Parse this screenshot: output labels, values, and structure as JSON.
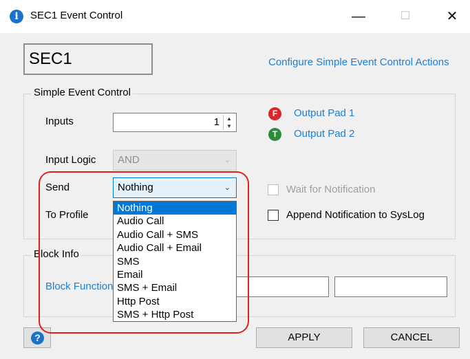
{
  "window": {
    "title": "SEC1 Event Control",
    "minimize_glyph": "—",
    "maximize_glyph": "☐",
    "close_glyph": "✕",
    "info_icon": "info-icon"
  },
  "header": {
    "block_name": "SEC1",
    "configure_link": "Configure Simple Event Control Actions"
  },
  "simple_event_control": {
    "group_label": "Simple Event Control",
    "inputs_label": "Inputs",
    "inputs_value": "1",
    "input_logic_label": "Input Logic",
    "input_logic_value": "AND",
    "send_label": "Send",
    "send_value": "Nothing",
    "to_profile_label": "To Profile",
    "send_options": [
      "Nothing",
      "Audio Call",
      "Audio Call + SMS",
      "Audio Call + Email",
      "SMS",
      "Email",
      "SMS + Email",
      "Http Post",
      "SMS + Http Post"
    ]
  },
  "outputs": [
    {
      "badge": "F",
      "label": "Output Pad 1",
      "color": "#d9262c"
    },
    {
      "badge": "T",
      "label": "Output Pad 2",
      "color": "#2e8b3d"
    }
  ],
  "options": {
    "wait_for_notification": "Wait for Notification",
    "append_syslog": "Append Notification to SysLog"
  },
  "block_info": {
    "group_label": "Block Info",
    "block_function_label": "Block Function"
  },
  "buttons": {
    "apply": "APPLY",
    "cancel": "CANCEL",
    "help_glyph": "?"
  },
  "colors": {
    "link": "#1c7fd3",
    "selection": "#0078d7",
    "highlight": "#e02020"
  }
}
